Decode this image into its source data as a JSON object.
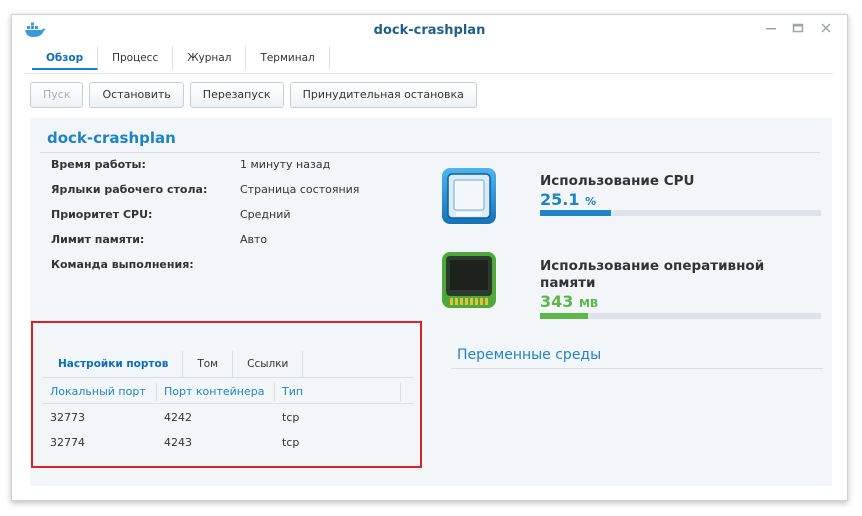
{
  "window": {
    "title": "dock-crashplan"
  },
  "tabs": [
    "Обзор",
    "Процесс",
    "Журнал",
    "Терминал"
  ],
  "toolbar": {
    "start": "Пуск",
    "stop": "Остановить",
    "restart": "Перезапуск",
    "force_stop": "Принудительная остановка"
  },
  "overview": {
    "title": "dock-crashplan",
    "rows": [
      {
        "label": "Время работы:",
        "value": "1 минуту назад"
      },
      {
        "label": "Ярлыки рабочего стола:",
        "value": "Страница состояния"
      },
      {
        "label": "Приоритет CPU:",
        "value": "Средний"
      },
      {
        "label": "Лимит памяти:",
        "value": "Авто"
      },
      {
        "label": "Команда выполнения:",
        "value": ""
      }
    ]
  },
  "cpu": {
    "title": "Использование CPU",
    "value": "25.1",
    "unit": "%",
    "percent": 25.1,
    "color": "#1e84c5"
  },
  "ram": {
    "title_line1": "Использование оперативной",
    "title_line2": "памяти",
    "value": "343",
    "unit": "MB",
    "percent": 17,
    "color": "#5cb648"
  },
  "port_settings": {
    "tabs": [
      "Настройки портов",
      "Том",
      "Ссылки"
    ],
    "columns": [
      "Локальный порт",
      "Порт контейнера",
      "Тип"
    ],
    "rows": [
      [
        "32773",
        "4242",
        "tcp"
      ],
      [
        "32774",
        "4243",
        "tcp"
      ]
    ]
  },
  "env": {
    "title": "Переменные среды"
  },
  "colors": {
    "accent": "#1e84c5",
    "highlight_border": "#d9232b"
  }
}
